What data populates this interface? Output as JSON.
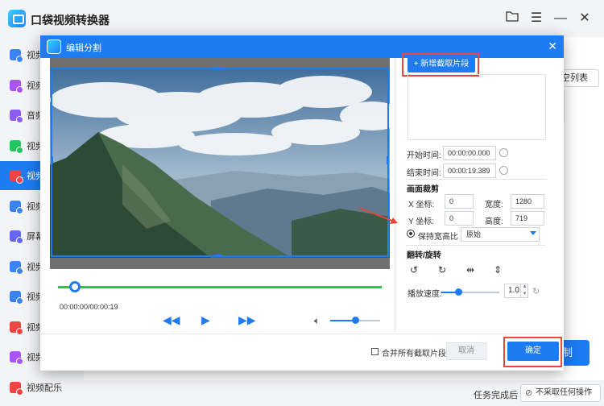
{
  "app": {
    "title": "口袋视频转换器",
    "clear_list_label": "清空列表",
    "convert_label": "制",
    "status_label": "任务完成后",
    "status_option": "不采取任何操作"
  },
  "sidebar": {
    "items": [
      {
        "label": "视频",
        "icon": "video-icon",
        "color": "#3b82f6"
      },
      {
        "label": "视频",
        "icon": "video-icon",
        "color": "#a855f7"
      },
      {
        "label": "音频",
        "icon": "audio-icon",
        "color": "#8b5cf6"
      },
      {
        "label": "视频",
        "icon": "video-icon",
        "color": "#22c55e"
      },
      {
        "label": "视频",
        "icon": "video-cut-icon",
        "color": "#ef4444"
      },
      {
        "label": "视频",
        "icon": "video-icon",
        "color": "#3b82f6"
      },
      {
        "label": "屏幕",
        "icon": "screen-record-icon",
        "color": "#6366f1"
      },
      {
        "label": "视频",
        "icon": "video-icon",
        "color": "#3b82f6"
      },
      {
        "label": "视频",
        "icon": "video-icon",
        "color": "#3b82f6"
      },
      {
        "label": "视频",
        "icon": "video-icon",
        "color": "#ef4444"
      },
      {
        "label": "视频",
        "icon": "video-icon",
        "color": "#a855f7"
      },
      {
        "label": "视频配乐",
        "icon": "music-icon",
        "color": "#ef4444"
      }
    ],
    "active_index": 4
  },
  "dialog": {
    "title": "编辑分割",
    "close_icon": "close-icon",
    "add_segment_label": "+ 新增截取片段",
    "start_time_label": "开始时间:",
    "start_time_value": "00:00:00.000",
    "end_time_label": "结束时间:",
    "end_time_value": "00:00:19.389",
    "crop_section_title": "画面裁剪",
    "x_label": "X 坐标:",
    "x_value": "0",
    "width_label": "宽度:",
    "width_value": "1280",
    "y_label": "Y 坐标:",
    "y_value": "0",
    "height_label": "高度:",
    "height_value": "719",
    "keep_ratio_label": "保持宽高比",
    "ratio_option": "原始",
    "flip_section_title": "翻转/旋转",
    "speed_label": "播放速度:",
    "speed_value": "1.0",
    "timecode": "00:00:00/00:00:19",
    "merge_label": "合并所有截取片段",
    "cancel_label": "取消",
    "ok_label": "确定"
  },
  "colors": {
    "accent": "#1d7cf2",
    "timeline": "#27c93f",
    "highlight": "#e8463c"
  }
}
